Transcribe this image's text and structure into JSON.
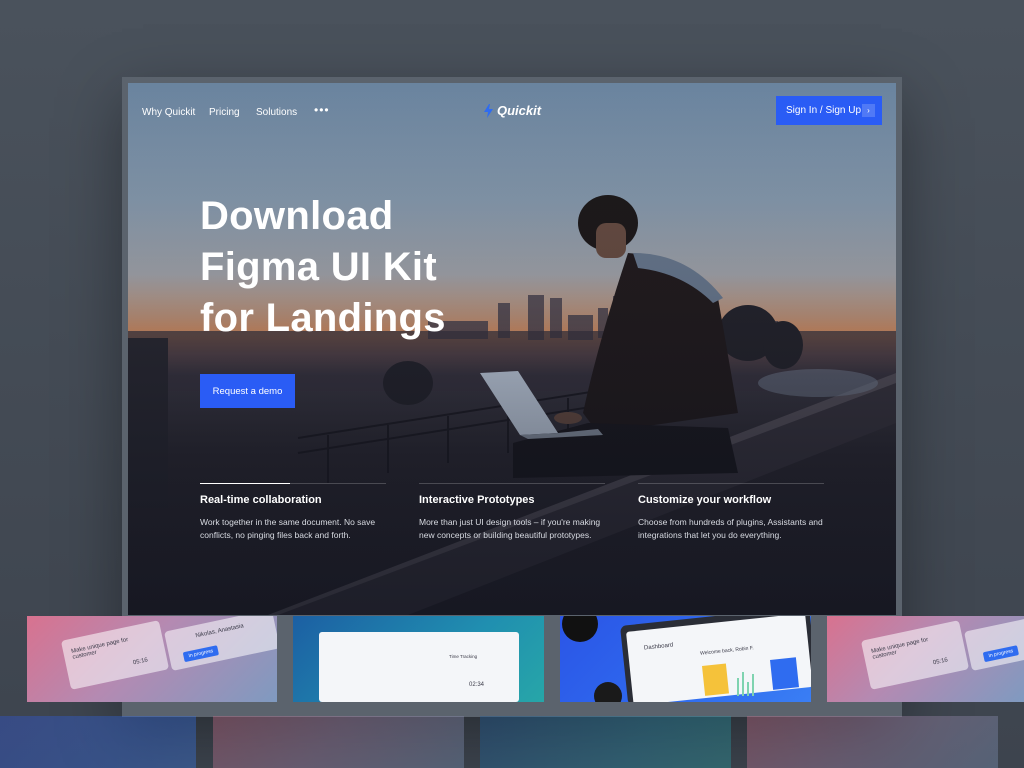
{
  "nav": {
    "links": [
      "Why Quickit",
      "Pricing",
      "Solutions"
    ],
    "more": "•••",
    "logo": "Quickit",
    "signin_label": "Sign In / Sign Up",
    "signin_arrow": "›"
  },
  "hero": {
    "headline": [
      "Download",
      "Figma UI Kit",
      "for Landings"
    ],
    "cta_label": "Request a demo"
  },
  "features": [
    {
      "title": "Real-time collaboration",
      "text": [
        "Work together in the same document. No save",
        "conflicts, no pinging files back and forth."
      ]
    },
    {
      "title": "Interactive Prototypes",
      "text": [
        "More than just UI design tools – if you're making",
        "new concepts or building beautiful prototypes."
      ]
    },
    {
      "title": "Customize your workflow",
      "text": [
        "Choose from hundreds of plugins, Assistants and",
        "integrations that let you do everything."
      ]
    }
  ],
  "thumbs": {
    "card_text": "Make unique page for customer",
    "time": "05:16",
    "status": "In progress",
    "user": "Nikolas, Anastasia",
    "time_tracking": "Time Tracking",
    "timer": "02:34",
    "dashboard": "Dashboard",
    "welcome": "Welcome back, Robin F."
  },
  "colors": {
    "accent": "#2a5cf5",
    "page_bg": "#464d57"
  }
}
